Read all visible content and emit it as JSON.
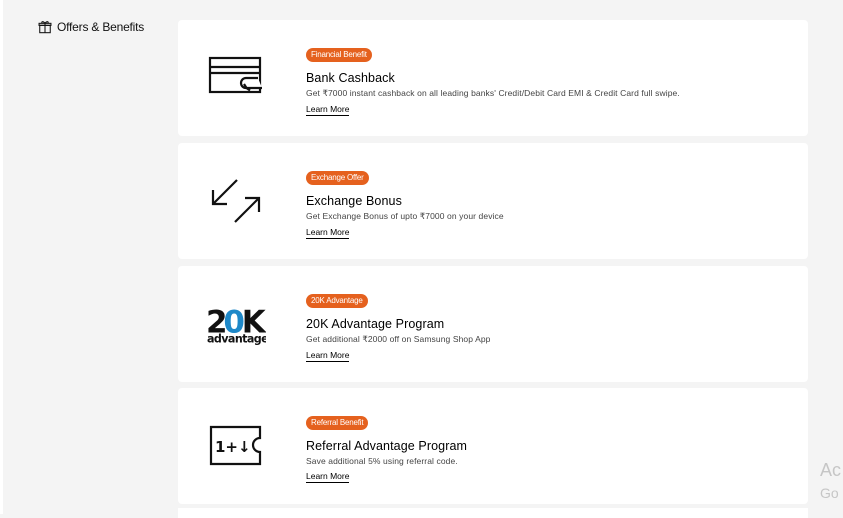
{
  "sidebar": {
    "title": "Offers & Benefits",
    "icon": "gift-icon"
  },
  "offers": [
    {
      "badge": "Financial Benefit",
      "title": "Bank Cashback",
      "description": "Get ₹7000 instant cashback on all leading banks' Credit/Debit Card EMI & Credit Card full swipe.",
      "link": "Learn More",
      "icon": "card-cashback-icon"
    },
    {
      "badge": "Exchange Offer",
      "title": "Exchange Bonus",
      "description": "Get Exchange Bonus of upto ₹7000 on your device",
      "link": "Learn More",
      "icon": "exchange-arrows-icon"
    },
    {
      "badge": "20K Advantage",
      "title": "20K Advantage Program",
      "description": "Get additional ₹2000 off on Samsung Shop App",
      "link": "Learn More",
      "icon": "20k-advantage-logo",
      "logo_text": {
        "top_left": "2",
        "top_accent": "0",
        "top_right": "K",
        "bottom": "advantage"
      }
    },
    {
      "badge": "Referral Benefit",
      "title": "Referral Advantage Program",
      "description": "Save additional 5% using referral code.",
      "link": "Learn More",
      "icon": "referral-ticket-icon",
      "ticket_text": "1+↓"
    }
  ],
  "watermark": {
    "line1": "Ac",
    "line2": "Go"
  },
  "colors": {
    "badge": "#e5611e",
    "accent_blue": "#1e88c8",
    "background": "#f4f4f4",
    "card": "#ffffff"
  }
}
